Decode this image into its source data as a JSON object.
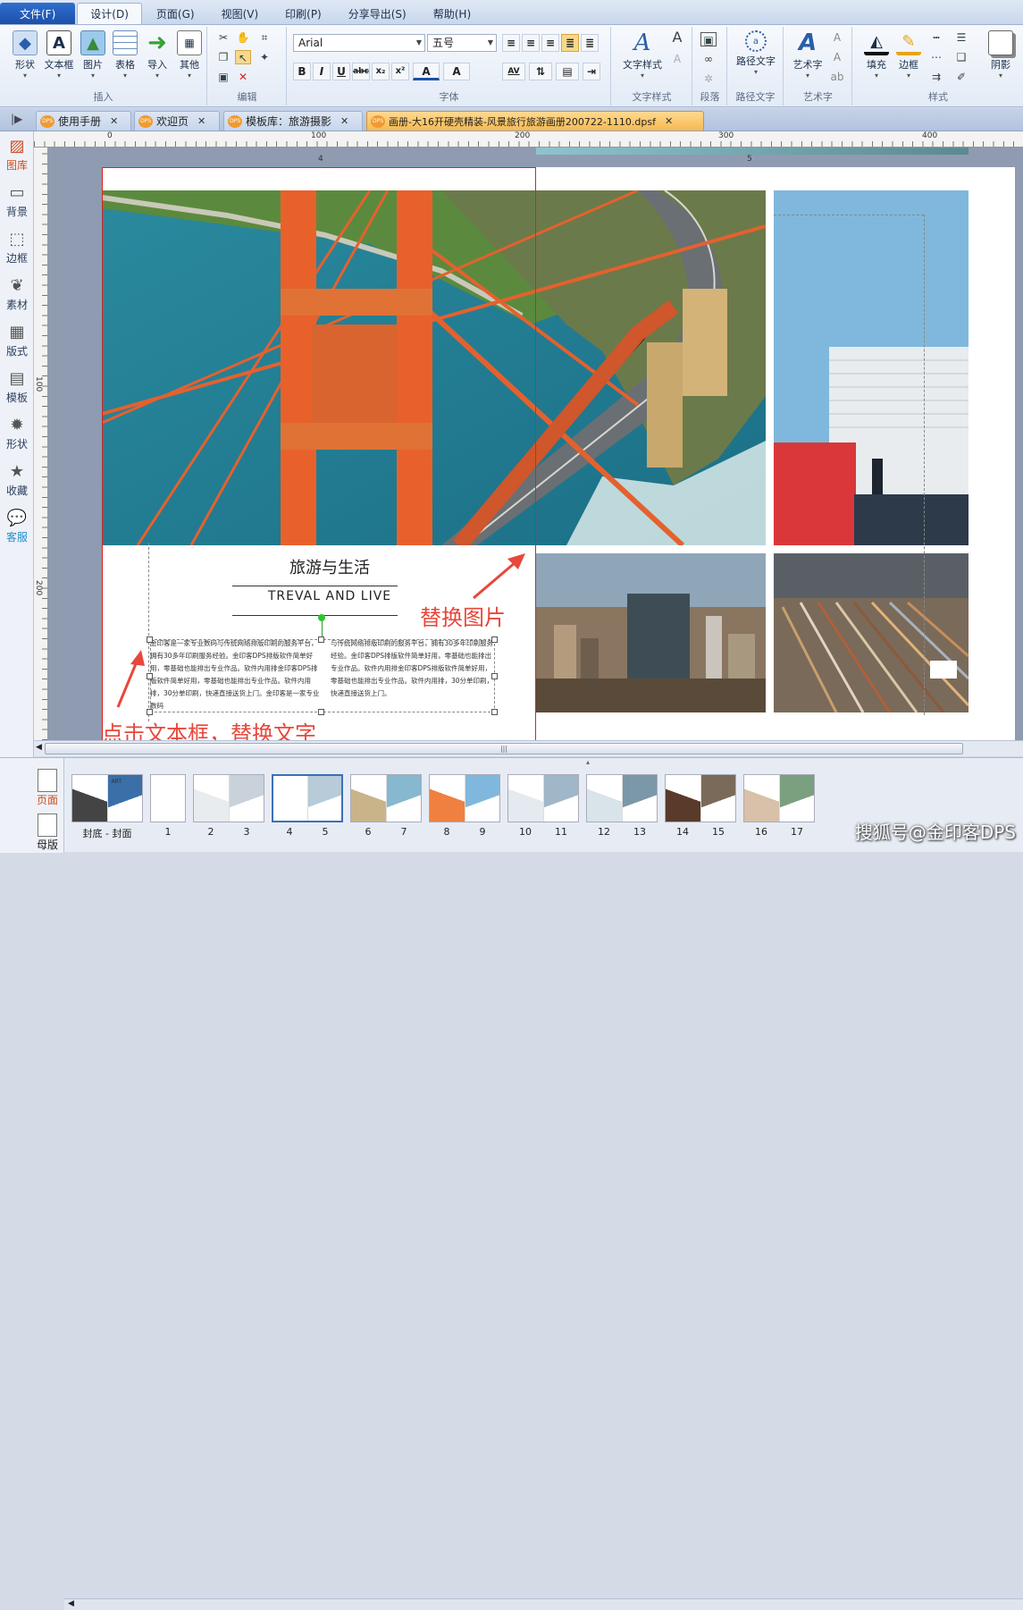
{
  "menu": {
    "tabs": [
      {
        "label": "文件(F)"
      },
      {
        "label": "设计(D)"
      },
      {
        "label": "页面(G)"
      },
      {
        "label": "视图(V)"
      },
      {
        "label": "印刷(P)"
      },
      {
        "label": "分享导出(S)"
      },
      {
        "label": "帮助(H)"
      }
    ]
  },
  "ribbon": {
    "insert": {
      "title": "插入",
      "buttons": [
        {
          "label": "形状",
          "icon": "shape-icon"
        },
        {
          "label": "文本框",
          "icon": "textbox-icon"
        },
        {
          "label": "图片",
          "icon": "image-icon"
        },
        {
          "label": "表格",
          "icon": "table-icon"
        },
        {
          "label": "导入",
          "icon": "import-icon"
        },
        {
          "label": "其他",
          "icon": "other-icon"
        }
      ]
    },
    "edit": {
      "title": "编辑"
    },
    "font": {
      "title": "字体",
      "family": "Arial",
      "size": "五号",
      "bold": "B",
      "italic": "I",
      "underline": "U",
      "strike": "abc",
      "sub": "x₂",
      "sup": "x²",
      "fontcolor": "A",
      "highlight": "A",
      "spacing": "AV"
    },
    "textstyle": {
      "title": "文字样式",
      "label": "文字样式"
    },
    "paragraph": {
      "title": "段落"
    },
    "pathtext": {
      "title": "路径文字",
      "label": "路径文字"
    },
    "arttext": {
      "title": "艺术字",
      "label": "艺术字"
    },
    "style": {
      "title": "样式",
      "fill": "填充",
      "border": "边框",
      "shadow": "阴影"
    }
  },
  "tabs": [
    {
      "label": "使用手册"
    },
    {
      "label": "欢迎页"
    },
    {
      "label": "模板库：旅游摄影"
    },
    {
      "label": "画册-大16开硬壳精装-风景旅行旅游画册200722-1110.dpsf"
    }
  ],
  "sidebar": {
    "items": [
      {
        "label": "图库",
        "icon": "gallery-icon"
      },
      {
        "label": "背景",
        "icon": "background-icon"
      },
      {
        "label": "边框",
        "icon": "border-icon"
      },
      {
        "label": "素材",
        "icon": "material-icon"
      },
      {
        "label": "版式",
        "icon": "layout-icon"
      },
      {
        "label": "模板",
        "icon": "template-icon"
      },
      {
        "label": "形状",
        "icon": "shape-icon"
      },
      {
        "label": "收藏",
        "icon": "star-icon"
      },
      {
        "label": "客服",
        "icon": "chat-icon"
      }
    ]
  },
  "ruler": {
    "h": [
      "0",
      "100",
      "200",
      "300",
      "400"
    ],
    "v": [
      "100",
      "200"
    ],
    "page_left": "4",
    "page_right": "5"
  },
  "page": {
    "title_cn": "旅游与生活",
    "title_en": "TREVAL AND LIVE",
    "body_left": "金印客是一家专业数码与传统网络排版印刷的服务平台，拥有30多年印刷服务经验。金印客DPS排版软件简单好用，零基础也能排出专业作品。软件内用排金印客DPS排版软件简单好用，零基础也能排出专业作品。软件内用排，30分单印刷，快递直接送货上门。金印客是一家专业数码",
    "body_right": "与传统网络排版印刷的服务平台，拥有30多年印刷服务经验。金印客DPS排版软件简单好用，零基础也能排出专业作品。软件内用排金印客DPS排版软件简单好用，零基础也能排出专业作品。软件内用排，30分单印刷，快递直接送货上门。"
  },
  "annotations": {
    "replace_image": "替换图片",
    "replace_text": "点击文本框，替换文字"
  },
  "thumbnails": {
    "side": [
      {
        "label": "页面"
      },
      {
        "label": "母版"
      }
    ],
    "pages": [
      "封底 - 封面",
      "1",
      "2",
      "3",
      "4",
      "5",
      "6",
      "7",
      "8",
      "9",
      "10",
      "11",
      "12",
      "13",
      "14",
      "15",
      "16",
      "17"
    ],
    "cover_art": "ART"
  },
  "watermark": "搜狐号@金印客DPS",
  "colors": {
    "accent": "#e8473b",
    "active_tab": "#f7b951",
    "brand": "#1d4fa8"
  }
}
